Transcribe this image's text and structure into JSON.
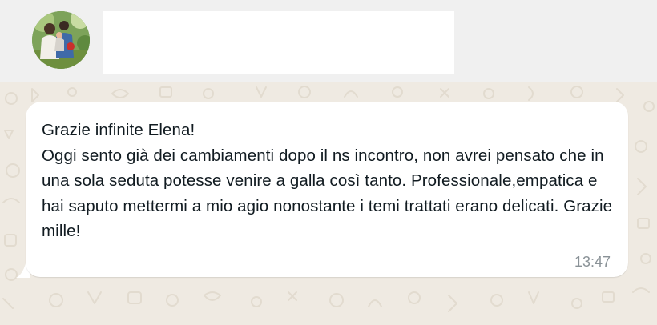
{
  "header": {
    "avatar_icon": "contact-photo-avatar",
    "contact_name": ""
  },
  "message": {
    "text": "Grazie infinite Elena!\nOggi sento già dei cambiamenti dopo il ns incontro, non avrei pensato che in una sola seduta potesse venire a galla così tanto. Professionale,empatica  e hai saputo mettermi a mio agio nonostante i temi trattati erano delicati. Grazie mille!",
    "time": "13:47"
  },
  "colors": {
    "header_bg": "#f0f0f0",
    "chat_bg": "#efeae2",
    "bubble_bg": "#ffffff",
    "text": "#111b21",
    "timestamp": "#8a9297"
  }
}
